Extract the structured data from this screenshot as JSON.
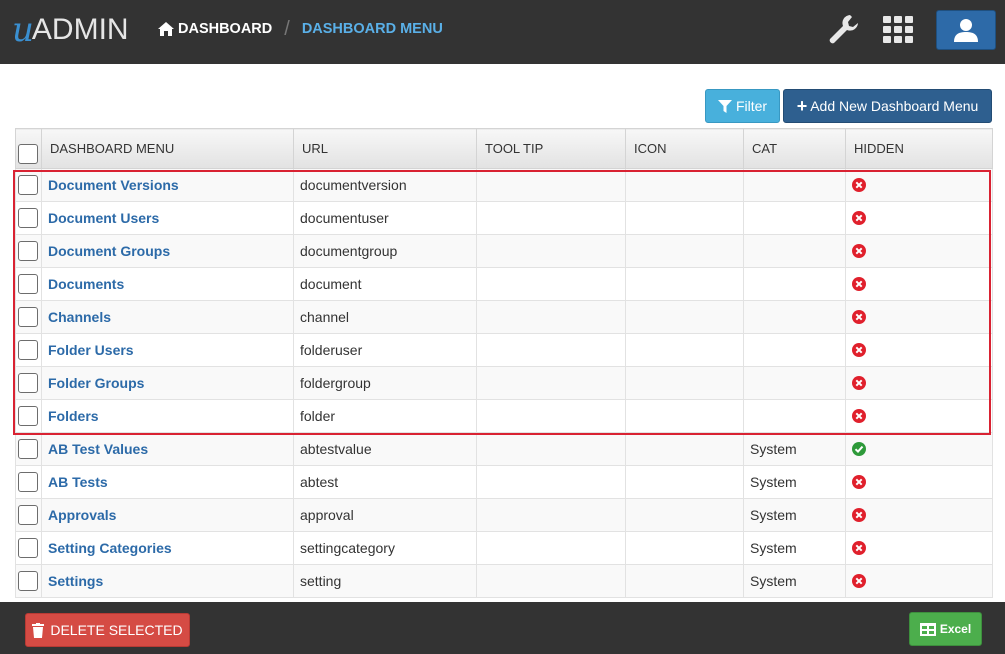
{
  "brand": {
    "prefix": "u",
    "name": "ADMIN"
  },
  "breadcrumb": {
    "home_icon": "home-icon",
    "home": "DASHBOARD",
    "current": "DASHBOARD MENU"
  },
  "header_icons": [
    "wrench-icon",
    "grid-icon",
    "user-icon"
  ],
  "toolbar": {
    "filter_label": "Filter",
    "add_label": "Add New Dashboard Menu"
  },
  "columns": [
    "DASHBOARD MENU",
    "URL",
    "TOOL TIP",
    "ICON",
    "CAT",
    "HIDDEN"
  ],
  "rows": [
    {
      "name": "Document Versions",
      "url": "documentversion",
      "tooltip": "",
      "icon": "",
      "cat": "",
      "hidden": "no"
    },
    {
      "name": "Document Users",
      "url": "documentuser",
      "tooltip": "",
      "icon": "",
      "cat": "",
      "hidden": "no"
    },
    {
      "name": "Document Groups",
      "url": "documentgroup",
      "tooltip": "",
      "icon": "",
      "cat": "",
      "hidden": "no"
    },
    {
      "name": "Documents",
      "url": "document",
      "tooltip": "",
      "icon": "",
      "cat": "",
      "hidden": "no"
    },
    {
      "name": "Channels",
      "url": "channel",
      "tooltip": "",
      "icon": "",
      "cat": "",
      "hidden": "no"
    },
    {
      "name": "Folder Users",
      "url": "folderuser",
      "tooltip": "",
      "icon": "",
      "cat": "",
      "hidden": "no"
    },
    {
      "name": "Folder Groups",
      "url": "foldergroup",
      "tooltip": "",
      "icon": "",
      "cat": "",
      "hidden": "no"
    },
    {
      "name": "Folders",
      "url": "folder",
      "tooltip": "",
      "icon": "",
      "cat": "",
      "hidden": "no"
    },
    {
      "name": "AB Test Values",
      "url": "abtestvalue",
      "tooltip": "",
      "icon": "",
      "cat": "System",
      "hidden": "yes"
    },
    {
      "name": "AB Tests",
      "url": "abtest",
      "tooltip": "",
      "icon": "",
      "cat": "System",
      "hidden": "no"
    },
    {
      "name": "Approvals",
      "url": "approval",
      "tooltip": "",
      "icon": "",
      "cat": "System",
      "hidden": "no"
    },
    {
      "name": "Setting Categories",
      "url": "settingcategory",
      "tooltip": "",
      "icon": "",
      "cat": "System",
      "hidden": "no"
    },
    {
      "name": "Settings",
      "url": "setting",
      "tooltip": "",
      "icon": "",
      "cat": "System",
      "hidden": "no"
    }
  ],
  "footer": {
    "delete_label": "DELETE SELECTED",
    "excel_label": "Excel"
  },
  "colors": {
    "topbar": "#333333",
    "link": "#2c6aa8",
    "no": "#e0202c",
    "yes": "#2e9a3a",
    "highlight": "#d92232"
  }
}
